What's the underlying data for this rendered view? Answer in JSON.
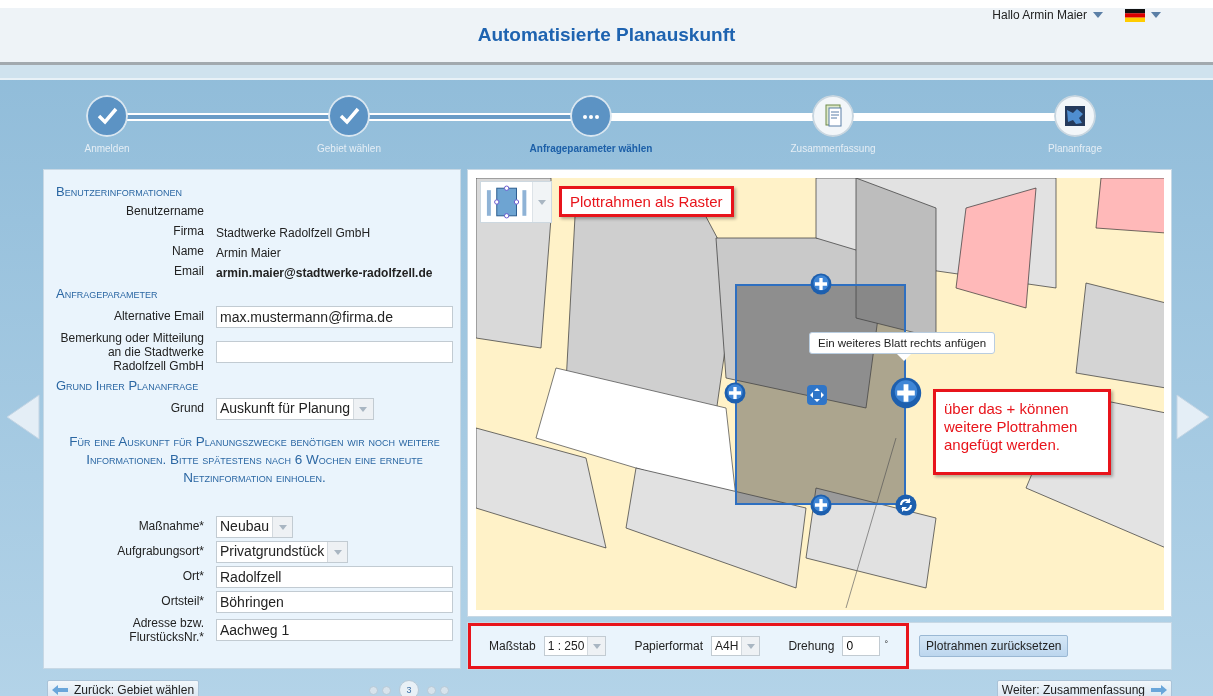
{
  "header": {
    "title": "Automatisierte Planauskunft",
    "user_menu": "Hallo Armin Maier"
  },
  "steps": [
    {
      "label": "Anmelden",
      "kind": "done",
      "selected": false
    },
    {
      "label": "Gebiet wählen",
      "kind": "done",
      "selected": false
    },
    {
      "label": "Anfrageparameter wählen",
      "kind": "current",
      "selected": true
    },
    {
      "label": "Zusammenfassung",
      "kind": "summary",
      "selected": false
    },
    {
      "label": "Plananfrage",
      "kind": "request",
      "selected": false
    }
  ],
  "form": {
    "sections": [
      {
        "heading": "Benutzerinformationen",
        "rows": [
          {
            "kind": "info",
            "label": "Benutzername"
          },
          {
            "kind": "info",
            "label": "Firma",
            "value": "Stadtwerke Radolfzell GmbH"
          },
          {
            "kind": "info",
            "label": "Name",
            "value": "Armin Maier"
          },
          {
            "kind": "info-strong",
            "label": "Email",
            "value": "armin.maier@stadtwerke-radolfzell.de"
          }
        ]
      },
      {
        "heading": "Anfrageparameter",
        "rows": [
          {
            "kind": "text",
            "label": "Alternative Email",
            "value": "max.mustermann@firma.de"
          },
          {
            "kind": "text",
            "label": "Bemerkung oder Mitteilung an die Stadtwerke Radolfzell GmbH"
          }
        ]
      },
      {
        "heading": "Grund Ihrer Plananfrage",
        "rows": [
          {
            "kind": "select",
            "label": "Grund",
            "value": "Auskunft für Planung"
          },
          {
            "kind": "notice",
            "text": "Für eine Auskunft für Planungszwecke benötigen wir noch weitere Informationen. Bitte spätestens nach 6 Wochen eine erneute Netzinformation einholen."
          },
          {
            "kind": "select",
            "label": "Maßnahme*",
            "value": "Neubau"
          },
          {
            "kind": "select",
            "label": "Aufgrabungsort*",
            "value": "Privatgrundstück"
          },
          {
            "kind": "text",
            "label": "Ort*",
            "value": "Radolfzell"
          },
          {
            "kind": "text",
            "label": "Ortsteil*",
            "value": "Böhringen"
          },
          {
            "kind": "text",
            "label": "Adresse bzw. FlurstücksNr.*",
            "value": "Aachweg 1"
          }
        ]
      }
    ]
  },
  "map": {
    "callout_top": "Plottrahmen als Raster",
    "tooltip": "Ein weiteres Blatt rechts anfügen",
    "callout_right": "über das + können weitere Plottrahmen angefügt werden."
  },
  "plot_settings": {
    "scale_label": "Maßstab",
    "scale": "1 : 250",
    "paper_label": "Papierformat",
    "paper": "A4H",
    "rotation_label": "Drehung",
    "rotation": "0",
    "rotation_unit": "°",
    "reset_button": "Plotrahmen zurücksetzen"
  },
  "footer": {
    "back_button": "Zurück: Gebiet wählen",
    "next_button": "Weiter: Zusammenfassung",
    "pages": [
      {
        "selected": false
      },
      {
        "selected": false
      },
      {
        "label": "3",
        "selected": true
      },
      {
        "selected": false
      },
      {
        "selected": false
      }
    ]
  }
}
